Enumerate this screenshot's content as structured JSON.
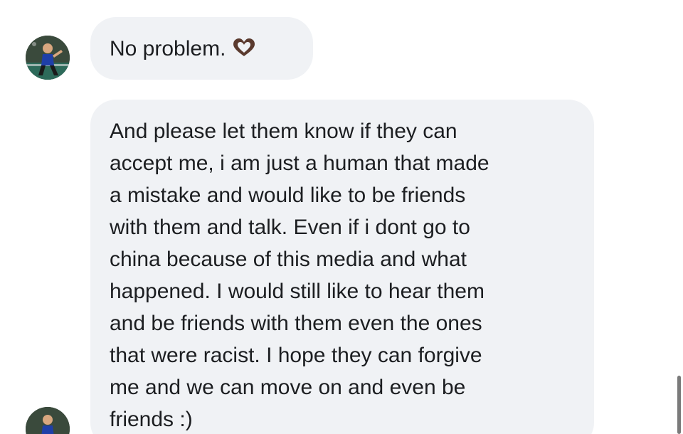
{
  "messages": [
    {
      "text": "No problem.",
      "reaction_icon": "heart-hands-icon"
    },
    {
      "lines": [
        "And please let them know if they can",
        "accept me, i am just a human that made",
        "a mistake and would like to be friends",
        "with them and talk. Even if i dont go to",
        "china because of this media and what",
        "happened. I would still like to hear them",
        "and be friends with them even the ones",
        "that were racist. I hope they can forgive",
        "me and we can move on and even be",
        "friends :)"
      ]
    }
  ],
  "colors": {
    "bubble_background": "#f0f2f5",
    "text": "#1c1e21",
    "page_background": "#ffffff"
  }
}
